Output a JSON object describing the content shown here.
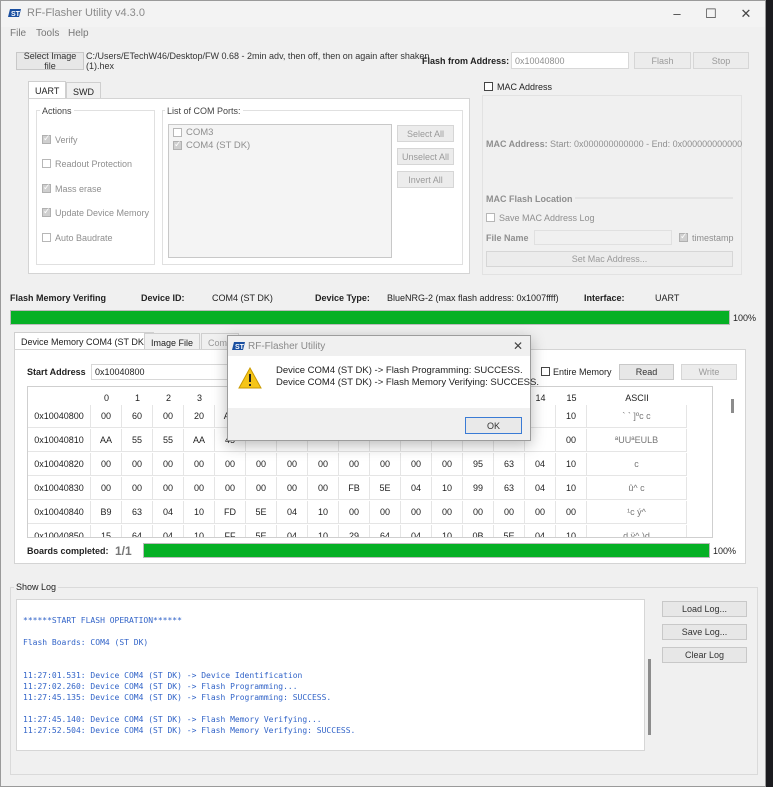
{
  "window": {
    "title": "RF-Flasher Utility v4.3.0"
  },
  "menu": [
    "File",
    "Tools",
    "Help"
  ],
  "top": {
    "select_image_label": "Select Image file",
    "file_path_line1": "C:/Users/ETechW46/Desktop/FW 0.68 - 2min adv, then off, then on again after shaken",
    "file_path_line2": "(1).hex",
    "flash_from_label": "Flash from Address:",
    "flash_from_value": "0x10040800",
    "flash_button": "Flash",
    "stop_button": "Stop"
  },
  "interface_tabs": [
    "UART",
    "SWD"
  ],
  "actions": {
    "title": "Actions",
    "items": [
      {
        "label": "Verify",
        "checked": true
      },
      {
        "label": "Readout Protection",
        "checked": false
      },
      {
        "label": "Mass erase",
        "checked": true
      },
      {
        "label": "Update Device Memory",
        "checked": true
      },
      {
        "label": "Auto Baudrate",
        "checked": false
      }
    ]
  },
  "com_ports": {
    "title": "List of COM Ports:",
    "items": [
      {
        "label": "COM3",
        "checked": false
      },
      {
        "label": "COM4 (ST DK)",
        "checked": true
      }
    ],
    "select_all": "Select All",
    "unselect_all": "Unselect All",
    "invert_all": "Invert All"
  },
  "mac": {
    "checkbox_label": "MAC Address",
    "address_label": "MAC Address:",
    "address_value": "Start: 0x000000000000 - End: 0x000000000000",
    "flash_location_label": "MAC Flash Location",
    "save_log_label": "Save MAC Address Log",
    "file_name_label": "File Name",
    "timestamp_label": "timestamp",
    "set_button": "Set Mac Address..."
  },
  "status": {
    "operation": "Flash Memory Verifing",
    "device_id_label": "Device ID:",
    "device_id_value": "COM4 (ST DK)",
    "device_type_label": "Device Type:",
    "device_type_value": "BlueNRG-2 (max flash address: 0x1007ffff)",
    "interface_label": "Interface:",
    "interface_value": "UART",
    "progress_percent_text": "100%",
    "progress_fraction": 1.0
  },
  "memory": {
    "tabs": [
      "Device Memory COM4 (ST DK)",
      "Image File",
      "Comp"
    ],
    "start_address_label": "Start Address",
    "start_address_value": "0x10040800",
    "entire_memory_label": "Entire Memory",
    "read_button": "Read",
    "write_button": "Write",
    "header": [
      "",
      "0",
      "1",
      "2",
      "3",
      "4",
      "5",
      "6",
      "7",
      "8",
      "9",
      "10",
      "11",
      "12",
      "13",
      "14",
      "15",
      "ASCII"
    ],
    "rows": [
      {
        "addr": "0x10040800",
        "cells": [
          "00",
          "60",
          "00",
          "20",
          "AD",
          "",
          "",
          "",
          "",
          "",
          "",
          "",
          "",
          "",
          "",
          "10"
        ],
        "ascii": "` ` ]ºc  c"
      },
      {
        "addr": "0x10040810",
        "cells": [
          "AA",
          "55",
          "55",
          "AA",
          "45",
          "",
          "",
          "",
          "",
          "",
          "",
          "",
          "",
          "",
          "",
          "00"
        ],
        "ascii": "ªUUªEULB"
      },
      {
        "addr": "0x10040820",
        "cells": [
          "00",
          "00",
          "00",
          "00",
          "00",
          "00",
          "00",
          "00",
          "00",
          "00",
          "00",
          "00",
          "95",
          "63",
          "04",
          "10"
        ],
        "ascii": "c"
      },
      {
        "addr": "0x10040830",
        "cells": [
          "00",
          "00",
          "00",
          "00",
          "00",
          "00",
          "00",
          "00",
          "FB",
          "5E",
          "04",
          "10",
          "99",
          "63",
          "04",
          "10"
        ],
        "ascii": "û^  c"
      },
      {
        "addr": "0x10040840",
        "cells": [
          "B9",
          "63",
          "04",
          "10",
          "FD",
          "5E",
          "04",
          "10",
          "00",
          "00",
          "00",
          "00",
          "00",
          "00",
          "00",
          "00"
        ],
        "ascii": "¹c ý^"
      },
      {
        "addr": "0x10040850",
        "cells": [
          "15",
          "64",
          "04",
          "10",
          "FF",
          "5E",
          "04",
          "10",
          "29",
          "64",
          "04",
          "10",
          "0B",
          "5E",
          "04",
          "10"
        ],
        "ascii": "d  ÿ^  )d"
      }
    ],
    "boards_label": "Boards completed:",
    "boards_value": "1/1",
    "boards_percent_text": "100%",
    "boards_fraction": 1.0
  },
  "log": {
    "title": "Show Log",
    "lines": [
      "******START FLASH OPERATION******",
      "",
      "Flash Boards: COM4 (ST DK)",
      "",
      "",
      "11:27:01.531: Device COM4 (ST DK) -> Device Identification",
      "11:27:02.260: Device COM4 (ST DK) -> Flash Programming...",
      "11:27:45.135: Device COM4 (ST DK) -> Flash Programming: SUCCESS.",
      "",
      "11:27:45.140: Device COM4 (ST DK) -> Flash Memory Verifying...",
      "11:27:52.504: Device COM4 (ST DK) -> Flash Memory Verifying: SUCCESS."
    ],
    "load_button": "Load Log...",
    "save_button": "Save Log...",
    "clear_button": "Clear Log"
  },
  "dialog": {
    "title": "RF-Flasher Utility",
    "line1": "Device COM4 (ST DK) -> Flash Programming: SUCCESS.",
    "line2": "Device COM4 (ST DK) -> Flash Memory Verifying: SUCCESS.",
    "ok_button": "OK"
  },
  "icons": {
    "app": "st-logo-icon",
    "warning": "warning-triangle-icon"
  },
  "colors": {
    "progress": "#06b025",
    "log_text": "#3264c8"
  }
}
